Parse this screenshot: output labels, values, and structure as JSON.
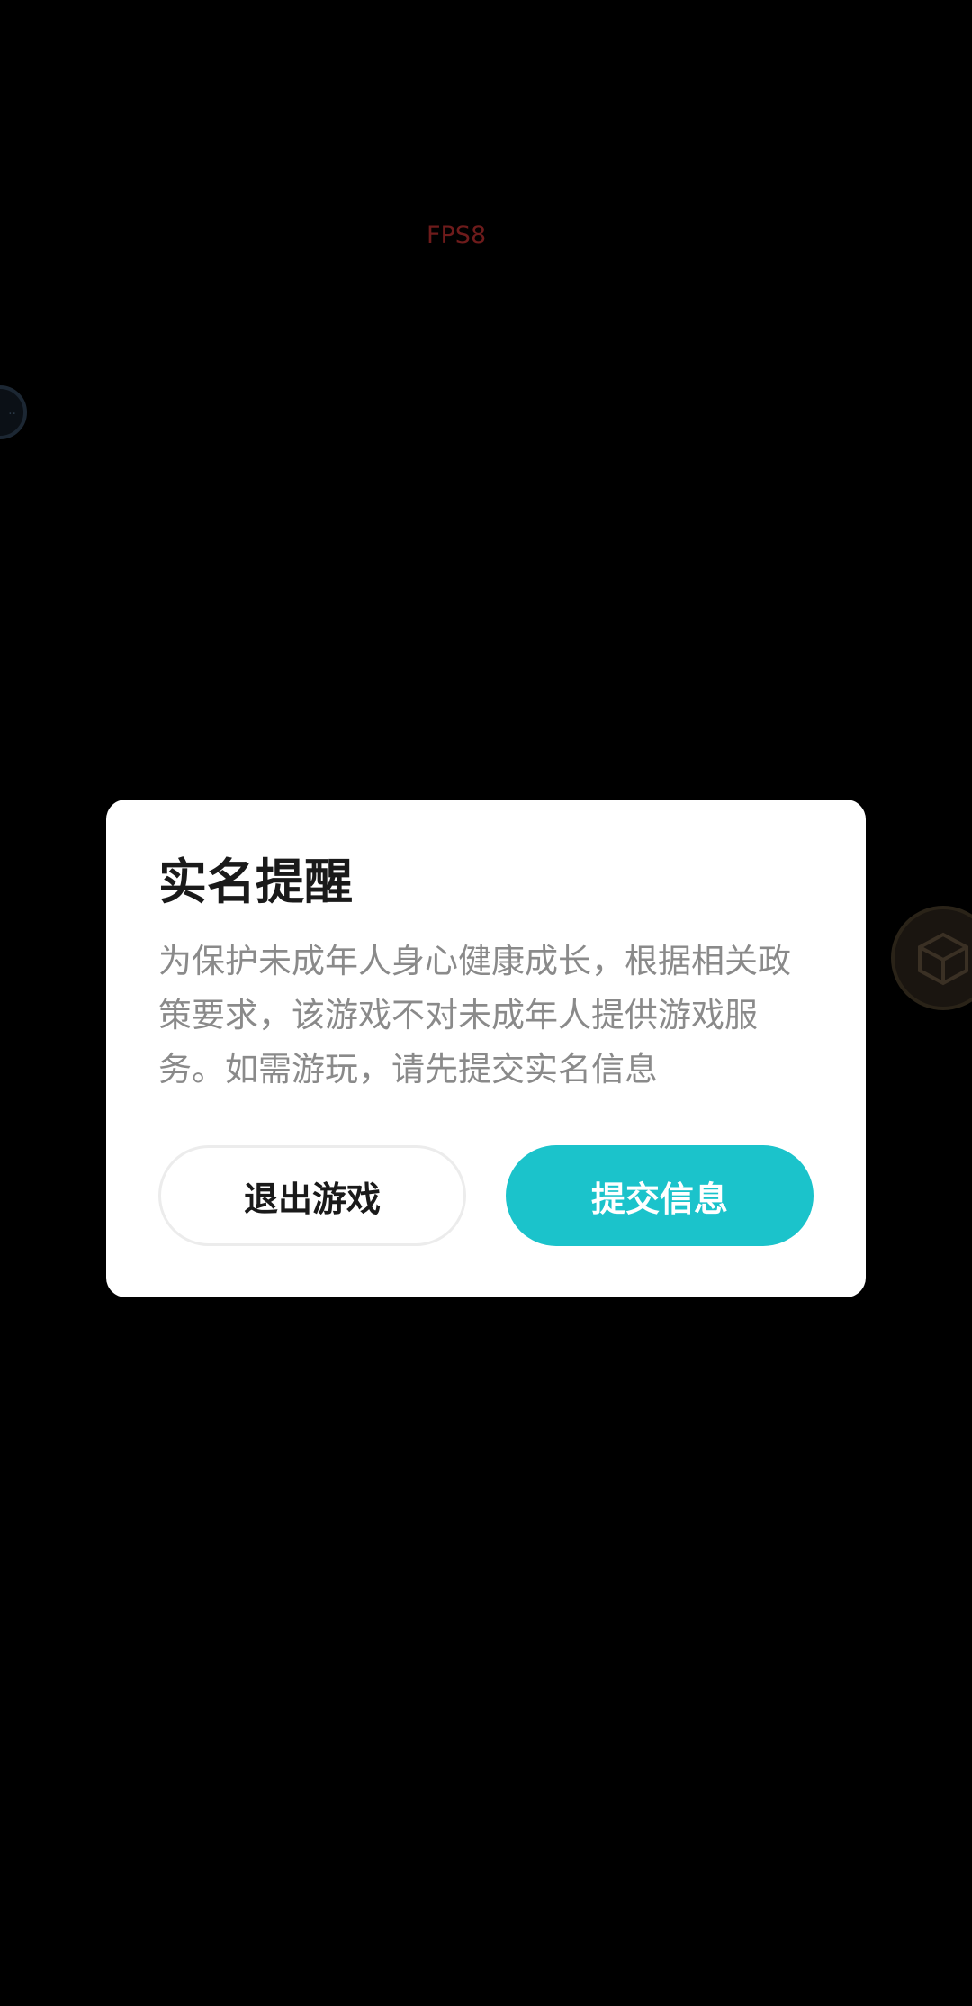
{
  "overlay": {
    "fps_text": "FPS8"
  },
  "dialog": {
    "title": "实名提醒",
    "message": "为保护未成年人身心健康成长，根据相关政策要求，该游戏不对未成年人提供游戏服务。如需游玩，请先提交实名信息",
    "exit_button_label": "退出游戏",
    "submit_button_label": "提交信息"
  },
  "colors": {
    "accent": "#1bc3cb",
    "dialog_background": "#ffffff",
    "screen_background": "#000000",
    "message_text": "#8a8a8a",
    "fps_text": "#6e1b1b"
  },
  "icons": {
    "left_floating": "floating-ball-icon",
    "right_floating": "cube-icon"
  }
}
